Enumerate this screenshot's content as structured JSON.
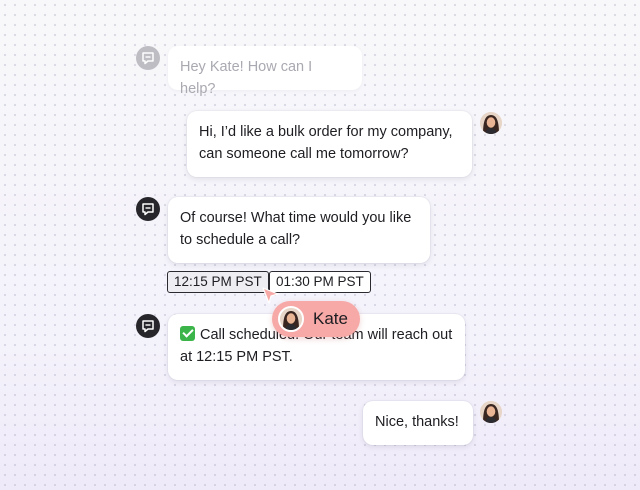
{
  "messages": [
    {
      "sender": "bot",
      "text": "Hey Kate! How can I help?",
      "faded": true
    },
    {
      "sender": "user",
      "line1": "Hi, I’d like a bulk order for my company,",
      "line2": "can someone call me tomorrow?"
    },
    {
      "sender": "bot",
      "line1": "Of course! What time would you like",
      "line2": "to schedule a call?"
    },
    {
      "sender": "bot",
      "line1": "Call scheduled. Our team will reach out",
      "line2": "at 12:15 PM PST.",
      "icon": "check-mark-icon"
    },
    {
      "sender": "user",
      "text": "Nice, thanks!"
    }
  ],
  "time_options": [
    {
      "label": "12:15 PM PST",
      "selected": true
    },
    {
      "label": "01:30 PM PST",
      "selected": false
    }
  ],
  "cursor": {
    "name": "Kate",
    "color": "#f6a9a6",
    "icon": "cursor-arrow-icon"
  },
  "colors": {
    "bot_avatar": "#26262b",
    "check": "#3bb54a",
    "background": "#f7f7fa"
  }
}
